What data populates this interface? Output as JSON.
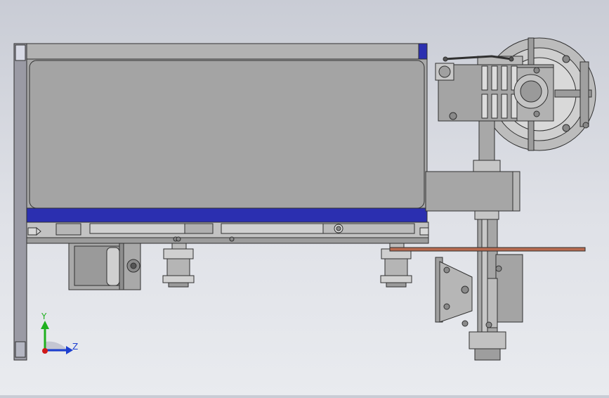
{
  "view": {
    "background_top": "#c9ccd5",
    "background_bottom": "#e9ebef"
  },
  "colors": {
    "metal": "#a4a4a4",
    "metal_dark": "#7d7d7d",
    "metal_light": "#c4c4c4",
    "frame_blue": "#2b2fb0",
    "copper": "#b86a4f",
    "outline": "#303030",
    "axis_y": "#1fb01f",
    "axis_z": "#1d3fd0",
    "origin": "#d01919"
  },
  "triad": {
    "y_label": "Y",
    "z_label": "Z",
    "y_icon": "y-axis-arrow-icon",
    "z_icon": "z-axis-arrow-icon"
  }
}
